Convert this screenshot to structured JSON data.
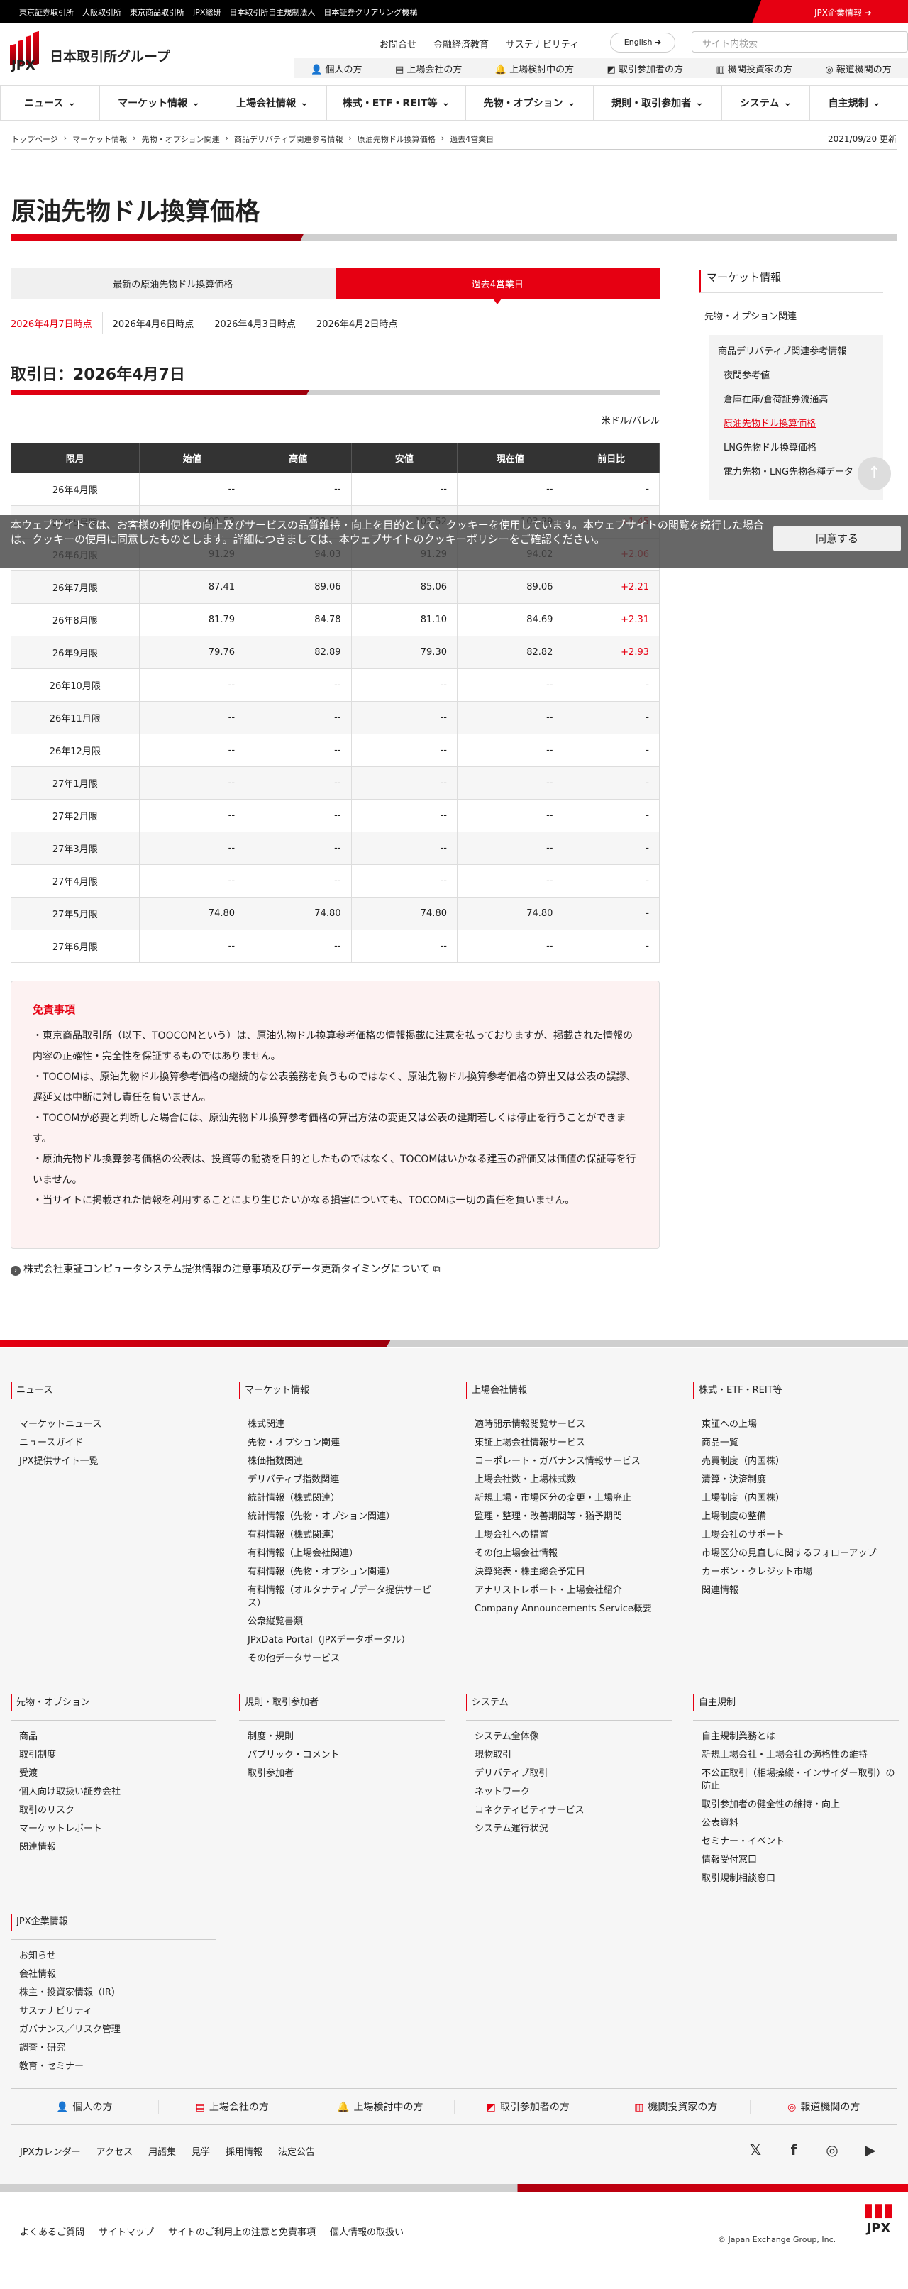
{
  "topbar": {
    "links": [
      "東京証券取引所",
      "大阪取引所",
      "東京商品取引所",
      "JPX総研",
      "日本取引所自主規制法人",
      "日本証券クリアリング機構"
    ],
    "corp": "JPX企業情報"
  },
  "logo": {
    "name": "日本取引所グループ",
    "abbr": "JPX"
  },
  "util": {
    "links": [
      "お問合せ",
      "金融経済教育",
      "サステナビリティ"
    ],
    "lang": "English",
    "search_placeholder": "サイト内検索"
  },
  "audience": [
    "個人の方",
    "上場会社の方",
    "上場検討中の方",
    "取引参加者の方",
    "機関投資家の方",
    "報道機関の方"
  ],
  "nav": [
    "ニュース",
    "マーケット情報",
    "上場会社情報",
    "株式・ETF・REIT等",
    "先物・オプション",
    "規則・取引参加者",
    "システム",
    "自主規制"
  ],
  "breadcrumb": [
    "トップページ",
    "マーケット情報",
    "先物・オプション関連",
    "商品デリバティブ関連参考情報",
    "原油先物ドル換算価格",
    "過去4営業日"
  ],
  "updated": "2021/09/20 更新",
  "title": "原油先物ドル換算価格",
  "tabs": [
    "最新の原油先物ドル換算価格",
    "過去4営業日"
  ],
  "dates": [
    "2026年4月7日時点",
    "2026年4月6日時点",
    "2026年4月3日時点",
    "2026年4月2日時点"
  ],
  "trade_date": "取引日：2026年4月7日",
  "unit": "米ドル/バレル",
  "table": {
    "headers": [
      "限月",
      "始値",
      "高値",
      "安値",
      "現在値",
      "前日比"
    ],
    "rows": [
      [
        "26年4月限",
        "--",
        "--",
        "--",
        "--",
        "-"
      ],
      [
        "26年5月限",
        "102.52",
        "103.51",
        "102.52",
        "103.29",
        "+1.45"
      ],
      [
        "26年6月限",
        "91.29",
        "94.03",
        "91.29",
        "94.02",
        "+2.06"
      ],
      [
        "26年7月限",
        "87.41",
        "89.06",
        "85.06",
        "89.06",
        "+2.21"
      ],
      [
        "26年8月限",
        "81.79",
        "84.78",
        "81.10",
        "84.69",
        "+2.31"
      ],
      [
        "26年9月限",
        "79.76",
        "82.89",
        "79.30",
        "82.82",
        "+2.93"
      ],
      [
        "26年10月限",
        "--",
        "--",
        "--",
        "--",
        "-"
      ],
      [
        "26年11月限",
        "--",
        "--",
        "--",
        "--",
        "-"
      ],
      [
        "26年12月限",
        "--",
        "--",
        "--",
        "--",
        "-"
      ],
      [
        "27年1月限",
        "--",
        "--",
        "--",
        "--",
        "-"
      ],
      [
        "27年2月限",
        "--",
        "--",
        "--",
        "--",
        "-"
      ],
      [
        "27年3月限",
        "--",
        "--",
        "--",
        "--",
        "-"
      ],
      [
        "27年4月限",
        "--",
        "--",
        "--",
        "--",
        "-"
      ],
      [
        "27年5月限",
        "74.80",
        "74.80",
        "74.80",
        "74.80",
        "-"
      ],
      [
        "27年6月限",
        "--",
        "--",
        "--",
        "--",
        "-"
      ]
    ]
  },
  "sidebar": {
    "heading": "マーケット情報",
    "category": "先物・オプション関連",
    "group": "商品デリバティブ関連参考情報",
    "items": [
      "夜間参考値",
      "倉庫在庫/倉荷証券流通高",
      "原油先物ドル換算価格",
      "LNG先物ドル換算価格",
      "電力先物・LNG先物各種データ"
    ],
    "current": "原油先物ドル換算価格"
  },
  "cookie": {
    "text1": "本ウェブサイトでは、お客様の利便性の向上及びサービスの品質維持・向上を目的として、クッキーを使用しています。本ウェブサイトの閲覧を続行した場合は、クッキーの使用に同意したものとします。詳細につきましては、本ウェブサイトの",
    "link": "クッキーポリシー",
    "text2": "をご確認ください。",
    "accept": "同意する"
  },
  "disclaimer": {
    "title": "免責事項",
    "items": [
      "・東京商品取引所（以下、TOOCOMという）は、原油先物ドル換算参考価格の情報掲載に注意を払っておりますが、掲載された情報の内容の正確性・完全性を保証するものではありません。",
      "・TOCOMは、原油先物ドル換算参考価格の継続的な公表義務を負うものではなく、原油先物ドル換算参考価格の算出又は公表の誤謬、遅延又は中断に対し責任を負いません。",
      "・TOCOMが必要と判断した場合には、原油先物ドル換算参考価格の算出方法の変更又は公表の延期若しくは停止を行うことができます。",
      "・原油先物ドル換算参考価格の公表は、投資等の勧誘を目的としたものではなく、TOCOMはいかなる建玉の評価又は価値の保証等を行いません。",
      "・当サイトに掲載された情報を利用することにより生じたいかなる損害についても、TOCOMは一切の責任を負いません。"
    ]
  },
  "ext_link": "株式会社東証コンピュータシステム提供情報の注意事項及びデータ更新タイミングについて",
  "footer": {
    "columns": [
      {
        "title": "ニュース",
        "items": [
          "マーケットニュース",
          "ニュースガイド",
          "JPX提供サイト一覧"
        ]
      },
      {
        "title": "マーケット情報",
        "items": [
          "株式関連",
          "先物・オプション関連",
          "株価指数関連",
          "デリバティブ指数関連",
          "統計情報（株式関連）",
          "統計情報（先物・オプション関連）",
          "有料情報（株式関連）",
          "有料情報（上場会社関連）",
          "有料情報（先物・オプション関連）",
          "有料情報（オルタナティブデータ提供サービス）",
          "公衆縦覧書類",
          "JPxData Portal（JPXデータポータル）",
          "その他データサービス"
        ]
      },
      {
        "title": "上場会社情報",
        "items": [
          "適時開示情報閲覧サービス",
          "東証上場会社情報サービス",
          "コーポレート・ガバナンス情報サービス",
          "上場会社数・上場株式数",
          "新規上場・市場区分の変更・上場廃止",
          "監理・整理・改善期間等・猶予期間",
          "上場会社への措置",
          "その他上場会社情報",
          "決算発表・株主総会予定日",
          "アナリストレポート・上場会社紹介",
          "Company Announcements Service概要"
        ]
      },
      {
        "title": "株式・ETF・REIT等",
        "items": [
          "東証への上場",
          "商品一覧",
          "売買制度（内国株）",
          "清算・決済制度",
          "上場制度（内国株）",
          "上場制度の整備",
          "上場会社のサポート",
          "市場区分の見直しに関するフォローアップ",
          "カーボン・クレジット市場",
          "関連情報"
        ]
      },
      {
        "title": "先物・オプション",
        "items": [
          "商品",
          "取引制度",
          "受渡",
          "個人向け取扱い証券会社",
          "取引のリスク",
          "マーケットレポート",
          "関連情報"
        ]
      },
      {
        "title": "規則・取引参加者",
        "items": [
          "制度・規則",
          "パブリック・コメント",
          "取引参加者"
        ]
      },
      {
        "title": "システム",
        "items": [
          "システム全体像",
          "現物取引",
          "デリバティブ取引",
          "ネットワーク",
          "コネクティビティサービス",
          "システム運行状況"
        ]
      },
      {
        "title": "自主規制",
        "items": [
          "自主規制業務とは",
          "新規上場会社・上場会社の適格性の維持",
          "不公正取引（相場操縦・インサイダー取引）の防止",
          "取引参加者の健全性の維持・向上",
          "公表資料",
          "セミナー・イベント",
          "情報受付窓口",
          "取引規制相談窓口"
        ]
      },
      {
        "title": "JPX企業情報",
        "items": [
          "お知らせ",
          "会社情報",
          "株主・投資家情報（IR）",
          "サステナビリティ",
          "ガバナンス／リスク管理",
          "調査・研究",
          "教育・セミナー"
        ]
      }
    ],
    "links": [
      "JPXカレンダー",
      "アクセス",
      "用語集",
      "見学",
      "採用情報",
      "法定公告"
    ],
    "social": [
      "x-icon",
      "facebook-icon",
      "instagram-icon",
      "youtube-icon"
    ],
    "bottom_links": [
      "よくあるご質問",
      "サイトマップ",
      "サイトのご利用上の注意と免責事項",
      "個人情報の取扱い"
    ],
    "copyright": "© Japan Exchange Group, Inc."
  },
  "colors": {
    "accent": "#e60012",
    "header_bg": "#333333"
  }
}
